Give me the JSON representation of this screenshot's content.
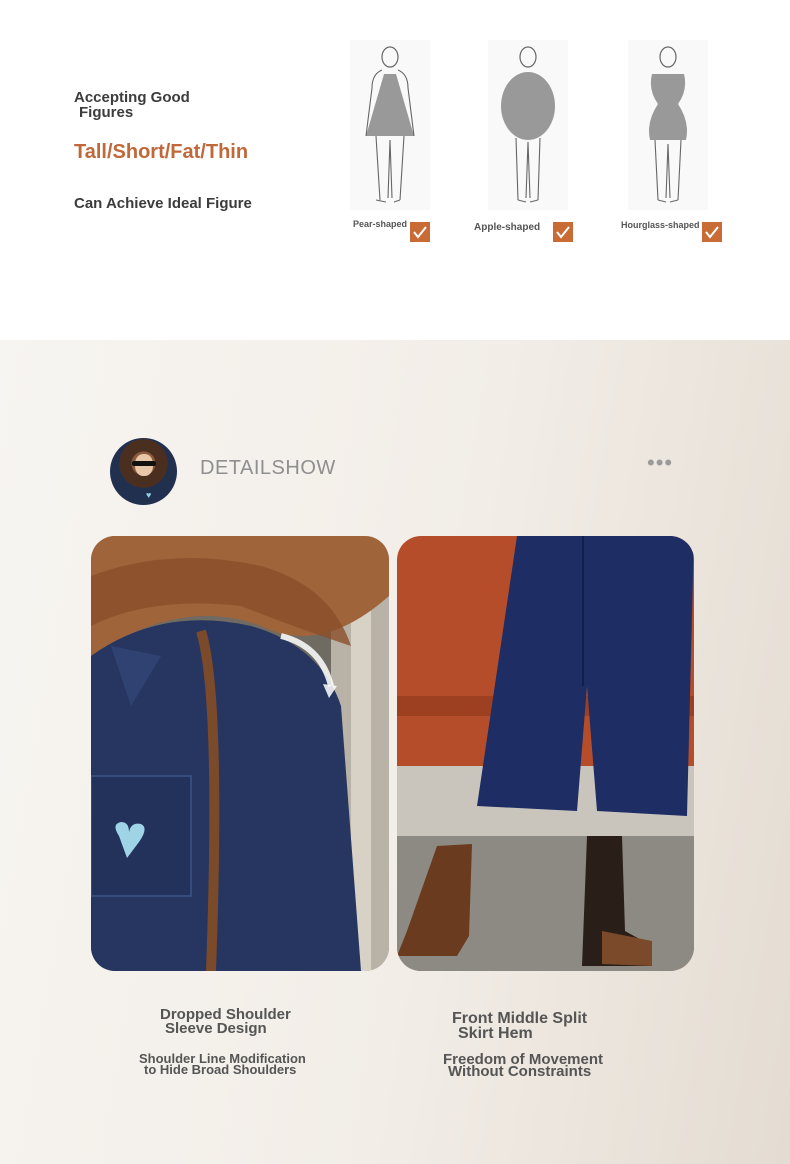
{
  "figures_section": {
    "claim_line1a": "Accepting Good",
    "claim_line1b": "Figures",
    "claim_highlight": "Tall/Short/Fat/Thin",
    "claim_line3": "Can Achieve Ideal Figure",
    "accent_color": "#c86b35",
    "body_types": [
      {
        "label": "Pear-shaped",
        "checked": true,
        "icon": "check-icon"
      },
      {
        "label": "Apple-shaped",
        "checked": true,
        "icon": "check-icon"
      },
      {
        "label": "Hourglass-shaped",
        "checked": true,
        "icon": "check-icon"
      }
    ]
  },
  "detail_section": {
    "title": "DETAILSHOW",
    "more_icon": "more-horizontal-icon",
    "left_feature": {
      "title_line1": "Dropped Shoulder",
      "title_line2": "Sleeve Design",
      "sub_line1": "Shoulder Line Modification",
      "sub_line2": "to Hide Broad Shoulders"
    },
    "right_feature": {
      "title_line1": "Front Middle Split",
      "title_line2": "Skirt Hem",
      "sub_line1": "Freedom of Movement",
      "sub_line2": "Without Constraints"
    }
  }
}
